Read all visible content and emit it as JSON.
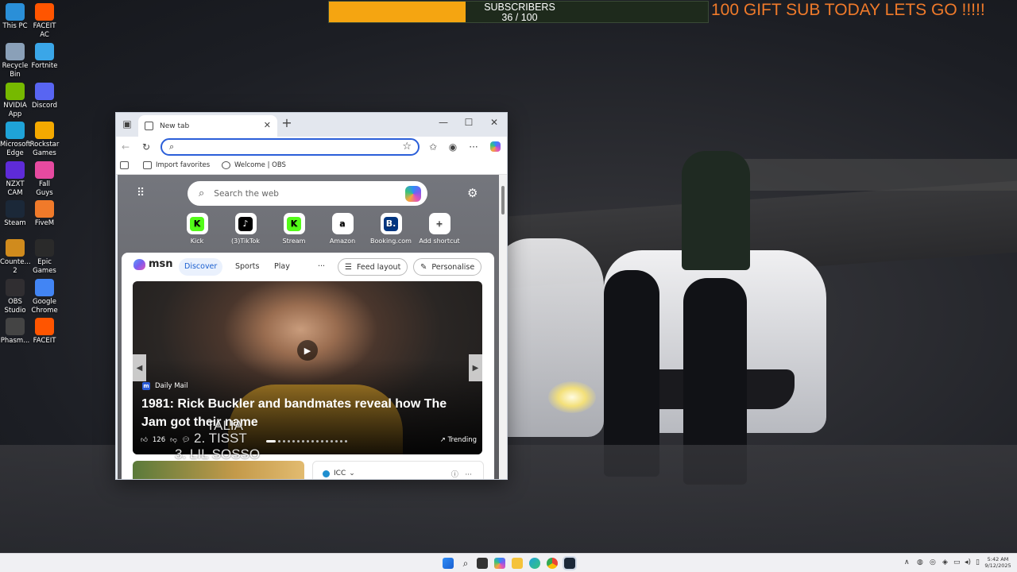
{
  "desktop": {
    "icons": [
      {
        "label": "This PC",
        "icon": "computer-icon",
        "color": "#2a8fd8"
      },
      {
        "label": "FACEIT AC",
        "icon": "faceit-ac-icon",
        "color": "#ff5500"
      },
      {
        "label": "Recycle Bin",
        "icon": "recycle-bin-icon",
        "color": "#8aa0b8"
      },
      {
        "label": "Fortnite",
        "icon": "fortnite-icon",
        "color": "#3aa6e8"
      },
      {
        "label": "NVIDIA App",
        "icon": "nvidia-icon",
        "color": "#76b900"
      },
      {
        "label": "Discord",
        "icon": "discord-icon",
        "color": "#5865f2"
      },
      {
        "label": "Microsoft Edge",
        "icon": "edge-icon",
        "color": "#1fa3d8"
      },
      {
        "label": "Rockstar Games ...",
        "icon": "rockstar-icon",
        "color": "#f4a900"
      },
      {
        "label": "NZXT CAM",
        "icon": "nzxt-cam-icon",
        "color": "#5e2bd8"
      },
      {
        "label": "Fall Guys",
        "icon": "fall-guys-icon",
        "color": "#e64aa0"
      },
      {
        "label": "Steam",
        "icon": "steam-icon",
        "color": "#1b2838"
      },
      {
        "label": "FiveM",
        "icon": "fivem-icon",
        "color": "#f07a2a"
      },
      {
        "label": "Counte... 2",
        "icon": "counter-strike-icon",
        "color": "#d08b1d"
      },
      {
        "label": "Epic Games ...",
        "icon": "epic-games-icon",
        "color": "#2a2a2a"
      },
      {
        "label": "OBS Studio",
        "icon": "obs-icon",
        "color": "#302e31"
      },
      {
        "label": "Google Chrome",
        "icon": "chrome-icon",
        "color": "#4285f4"
      },
      {
        "label": "Phasm...",
        "icon": "phasmophobia-icon",
        "color": "#444444"
      },
      {
        "label": "FACEIT",
        "icon": "faceit-icon",
        "color": "#ff5500"
      }
    ]
  },
  "overlay": {
    "subscribers_label": "SUBSCRIBERS",
    "subscribers_count": "36 / 100",
    "subscribers_progress": 0.36,
    "gift_message": "100 GIFT SUB TODAY LETS GO !!!!!",
    "stream_text_1": "TALIA",
    "stream_text_2": "2. TISST",
    "stream_text_3": "3. LIL SOSSO"
  },
  "browser": {
    "tab_title": "New tab",
    "address_value": "",
    "favorites": [
      {
        "label": "Import favorites",
        "icon": "import-icon"
      },
      {
        "label": "Welcome | OBS",
        "icon": "globe-icon"
      }
    ],
    "search_placeholder": "Search the web",
    "shortcuts": [
      {
        "label": "Kick",
        "glyph": "K",
        "bg": "#53fc18",
        "fg": "#000"
      },
      {
        "label": "(3)TikTok",
        "glyph": "♪",
        "bg": "#000000",
        "fg": "#fff"
      },
      {
        "label": "Stream",
        "glyph": "K",
        "bg": "#53fc18",
        "fg": "#000"
      },
      {
        "label": "Amazon",
        "glyph": "a",
        "bg": "#ffffff",
        "fg": "#000"
      },
      {
        "label": "Booking.com",
        "glyph": "B.",
        "bg": "#003580",
        "fg": "#fff"
      },
      {
        "label": "Add shortcut",
        "glyph": "+",
        "bg": "#ffffff",
        "fg": "#444"
      }
    ],
    "feed": {
      "brand": "msn",
      "nav": [
        "Discover",
        "Sports",
        "Play"
      ],
      "more": "···",
      "feed_layout": "Feed layout",
      "personalise": "Personalise",
      "hero": {
        "source": "Daily Mail",
        "headline": "1981: Rick Buckler and bandmates reveal how The Jam got their name",
        "likes": "126",
        "trending": "Trending"
      },
      "card3_source": "ICC"
    }
  },
  "taskbar": {
    "time": "5:42 AM",
    "date": "9/12/2025"
  }
}
